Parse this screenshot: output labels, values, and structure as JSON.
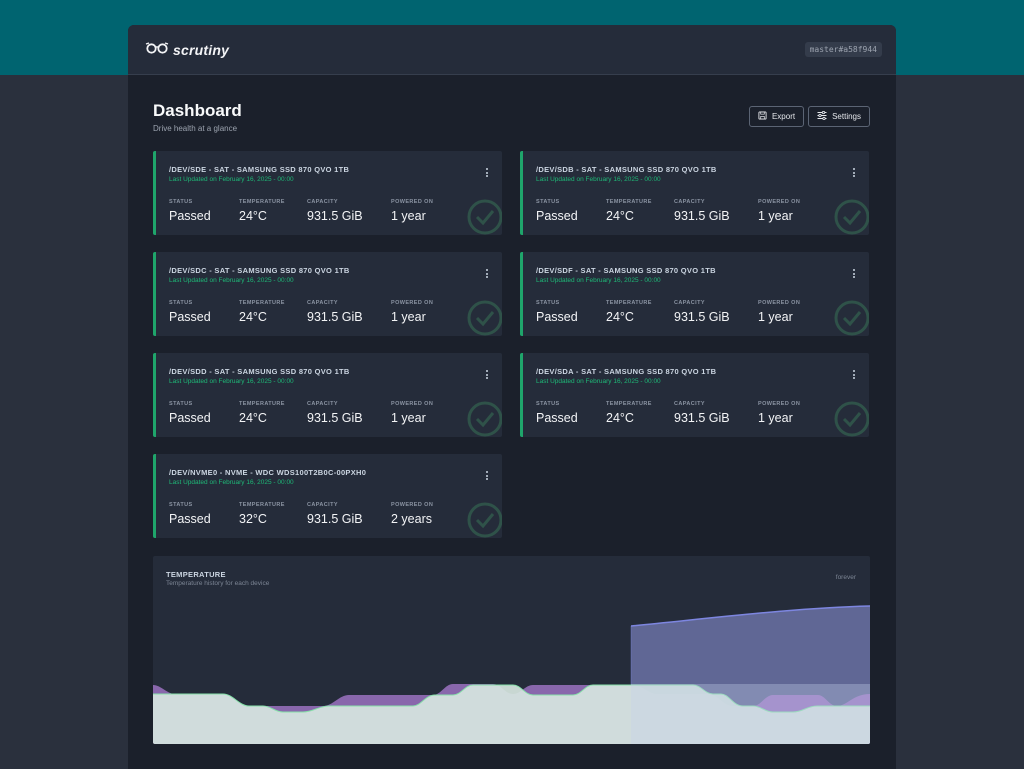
{
  "app": {
    "logo_text": "scrutiny",
    "version": "master#a58f944"
  },
  "page": {
    "title": "Dashboard",
    "subtitle": "Drive health at a glance"
  },
  "buttons": {
    "export": "Export",
    "settings": "Settings"
  },
  "stat_labels": {
    "status": "STATUS",
    "temperature": "TEMPERATURE",
    "capacity": "CAPACITY",
    "powered_on": "POWERED ON"
  },
  "devices": [
    {
      "title": "/DEV/SDE - SAT - SAMSUNG SSD 870 QVO 1TB",
      "updated": "Last Updated on February 16, 2025 - 00:00",
      "status": "Passed",
      "temperature": "24°C",
      "capacity": "931.5 GiB",
      "powered_on": "1 year"
    },
    {
      "title": "/DEV/SDB - SAT - SAMSUNG SSD 870 QVO 1TB",
      "updated": "Last Updated on February 16, 2025 - 00:00",
      "status": "Passed",
      "temperature": "24°C",
      "capacity": "931.5 GiB",
      "powered_on": "1 year"
    },
    {
      "title": "/DEV/SDC - SAT - SAMSUNG SSD 870 QVO 1TB",
      "updated": "Last Updated on February 16, 2025 - 00:00",
      "status": "Passed",
      "temperature": "24°C",
      "capacity": "931.5 GiB",
      "powered_on": "1 year"
    },
    {
      "title": "/DEV/SDF - SAT - SAMSUNG SSD 870 QVO 1TB",
      "updated": "Last Updated on February 16, 2025 - 00:00",
      "status": "Passed",
      "temperature": "24°C",
      "capacity": "931.5 GiB",
      "powered_on": "1 year"
    },
    {
      "title": "/DEV/SDD - SAT - SAMSUNG SSD 870 QVO 1TB",
      "updated": "Last Updated on February 16, 2025 - 00:00",
      "status": "Passed",
      "temperature": "24°C",
      "capacity": "931.5 GiB",
      "powered_on": "1 year"
    },
    {
      "title": "/DEV/SDA - SAT - SAMSUNG SSD 870 QVO 1TB",
      "updated": "Last Updated on February 16, 2025 - 00:00",
      "status": "Passed",
      "temperature": "24°C",
      "capacity": "931.5 GiB",
      "powered_on": "1 year"
    },
    {
      "title": "/DEV/NVME0 - NVME - WDC WDS100T2B0C-00PXH0",
      "updated": "Last Updated on February 16, 2025 - 00:00",
      "status": "Passed",
      "temperature": "32°C",
      "capacity": "931.5 GiB",
      "powered_on": "2 years"
    }
  ],
  "temperature_panel": {
    "title": "TEMPERATURE",
    "subtitle": "Temperature history for each device",
    "range": "forever"
  },
  "colors": {
    "accent_teal": "#006470",
    "status_passed": "#1fa56b",
    "series_blue": "#6d7ad8",
    "series_violet": "#b07ad8",
    "series_green": "#86e0a9"
  }
}
